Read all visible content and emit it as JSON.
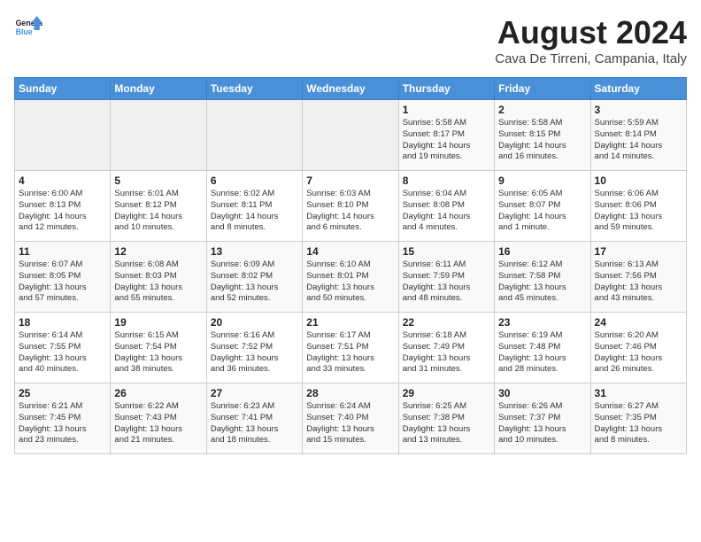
{
  "header": {
    "logo_general": "General",
    "logo_blue": "Blue",
    "month_title": "August 2024",
    "location": "Cava De Tirreni, Campania, Italy"
  },
  "days_of_week": [
    "Sunday",
    "Monday",
    "Tuesday",
    "Wednesday",
    "Thursday",
    "Friday",
    "Saturday"
  ],
  "weeks": [
    [
      {
        "day": "",
        "content": ""
      },
      {
        "day": "",
        "content": ""
      },
      {
        "day": "",
        "content": ""
      },
      {
        "day": "",
        "content": ""
      },
      {
        "day": "1",
        "content": "Sunrise: 5:58 AM\nSunset: 8:17 PM\nDaylight: 14 hours\nand 19 minutes."
      },
      {
        "day": "2",
        "content": "Sunrise: 5:58 AM\nSunset: 8:15 PM\nDaylight: 14 hours\nand 16 minutes."
      },
      {
        "day": "3",
        "content": "Sunrise: 5:59 AM\nSunset: 8:14 PM\nDaylight: 14 hours\nand 14 minutes."
      }
    ],
    [
      {
        "day": "4",
        "content": "Sunrise: 6:00 AM\nSunset: 8:13 PM\nDaylight: 14 hours\nand 12 minutes."
      },
      {
        "day": "5",
        "content": "Sunrise: 6:01 AM\nSunset: 8:12 PM\nDaylight: 14 hours\nand 10 minutes."
      },
      {
        "day": "6",
        "content": "Sunrise: 6:02 AM\nSunset: 8:11 PM\nDaylight: 14 hours\nand 8 minutes."
      },
      {
        "day": "7",
        "content": "Sunrise: 6:03 AM\nSunset: 8:10 PM\nDaylight: 14 hours\nand 6 minutes."
      },
      {
        "day": "8",
        "content": "Sunrise: 6:04 AM\nSunset: 8:08 PM\nDaylight: 14 hours\nand 4 minutes."
      },
      {
        "day": "9",
        "content": "Sunrise: 6:05 AM\nSunset: 8:07 PM\nDaylight: 14 hours\nand 1 minute."
      },
      {
        "day": "10",
        "content": "Sunrise: 6:06 AM\nSunset: 8:06 PM\nDaylight: 13 hours\nand 59 minutes."
      }
    ],
    [
      {
        "day": "11",
        "content": "Sunrise: 6:07 AM\nSunset: 8:05 PM\nDaylight: 13 hours\nand 57 minutes."
      },
      {
        "day": "12",
        "content": "Sunrise: 6:08 AM\nSunset: 8:03 PM\nDaylight: 13 hours\nand 55 minutes."
      },
      {
        "day": "13",
        "content": "Sunrise: 6:09 AM\nSunset: 8:02 PM\nDaylight: 13 hours\nand 52 minutes."
      },
      {
        "day": "14",
        "content": "Sunrise: 6:10 AM\nSunset: 8:01 PM\nDaylight: 13 hours\nand 50 minutes."
      },
      {
        "day": "15",
        "content": "Sunrise: 6:11 AM\nSunset: 7:59 PM\nDaylight: 13 hours\nand 48 minutes."
      },
      {
        "day": "16",
        "content": "Sunrise: 6:12 AM\nSunset: 7:58 PM\nDaylight: 13 hours\nand 45 minutes."
      },
      {
        "day": "17",
        "content": "Sunrise: 6:13 AM\nSunset: 7:56 PM\nDaylight: 13 hours\nand 43 minutes."
      }
    ],
    [
      {
        "day": "18",
        "content": "Sunrise: 6:14 AM\nSunset: 7:55 PM\nDaylight: 13 hours\nand 40 minutes."
      },
      {
        "day": "19",
        "content": "Sunrise: 6:15 AM\nSunset: 7:54 PM\nDaylight: 13 hours\nand 38 minutes."
      },
      {
        "day": "20",
        "content": "Sunrise: 6:16 AM\nSunset: 7:52 PM\nDaylight: 13 hours\nand 36 minutes."
      },
      {
        "day": "21",
        "content": "Sunrise: 6:17 AM\nSunset: 7:51 PM\nDaylight: 13 hours\nand 33 minutes."
      },
      {
        "day": "22",
        "content": "Sunrise: 6:18 AM\nSunset: 7:49 PM\nDaylight: 13 hours\nand 31 minutes."
      },
      {
        "day": "23",
        "content": "Sunrise: 6:19 AM\nSunset: 7:48 PM\nDaylight: 13 hours\nand 28 minutes."
      },
      {
        "day": "24",
        "content": "Sunrise: 6:20 AM\nSunset: 7:46 PM\nDaylight: 13 hours\nand 26 minutes."
      }
    ],
    [
      {
        "day": "25",
        "content": "Sunrise: 6:21 AM\nSunset: 7:45 PM\nDaylight: 13 hours\nand 23 minutes."
      },
      {
        "day": "26",
        "content": "Sunrise: 6:22 AM\nSunset: 7:43 PM\nDaylight: 13 hours\nand 21 minutes."
      },
      {
        "day": "27",
        "content": "Sunrise: 6:23 AM\nSunset: 7:41 PM\nDaylight: 13 hours\nand 18 minutes."
      },
      {
        "day": "28",
        "content": "Sunrise: 6:24 AM\nSunset: 7:40 PM\nDaylight: 13 hours\nand 15 minutes."
      },
      {
        "day": "29",
        "content": "Sunrise: 6:25 AM\nSunset: 7:38 PM\nDaylight: 13 hours\nand 13 minutes."
      },
      {
        "day": "30",
        "content": "Sunrise: 6:26 AM\nSunset: 7:37 PM\nDaylight: 13 hours\nand 10 minutes."
      },
      {
        "day": "31",
        "content": "Sunrise: 6:27 AM\nSunset: 7:35 PM\nDaylight: 13 hours\nand 8 minutes."
      }
    ]
  ]
}
